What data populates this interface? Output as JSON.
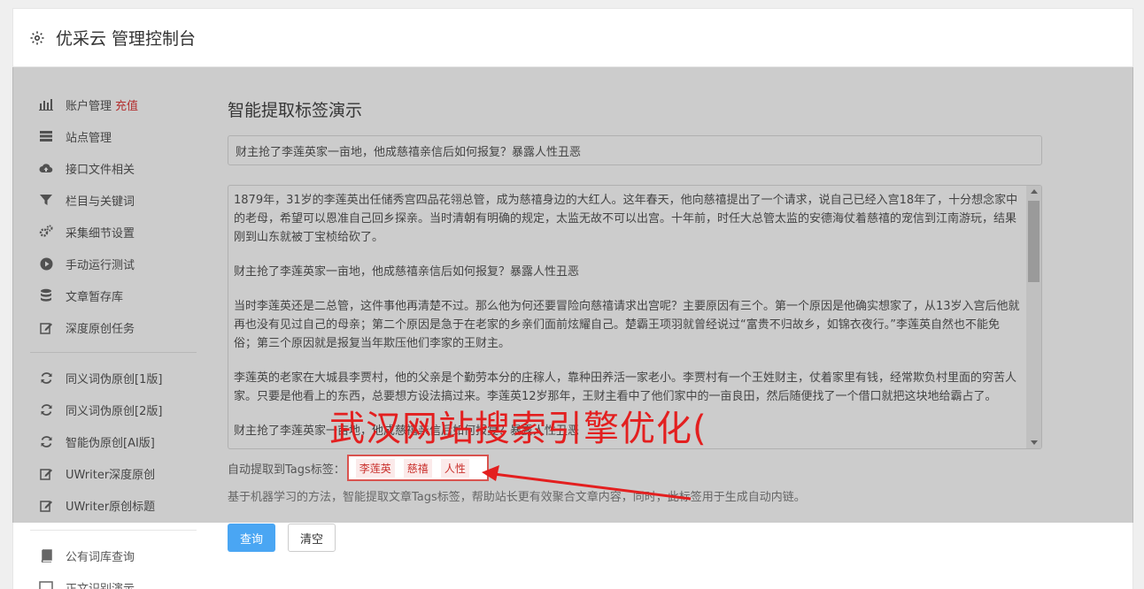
{
  "header": {
    "title": "优采云 管理控制台",
    "icon": "gear-icon"
  },
  "sidebar": {
    "items": [
      {
        "label": "账户管理",
        "badge": "充值",
        "icon": "bar-chart-icon"
      },
      {
        "label": "站点管理",
        "icon": "server-icon"
      },
      {
        "label": "接口文件相关",
        "icon": "cloud-upload-icon"
      },
      {
        "label": "栏目与关键词",
        "icon": "filter-icon"
      },
      {
        "label": "采集细节设置",
        "icon": "gears-icon"
      },
      {
        "label": "手动运行测试",
        "icon": "play-circle-icon"
      },
      {
        "label": "文章暂存库",
        "icon": "database-icon"
      },
      {
        "label": "深度原创任务",
        "icon": "edit-icon"
      }
    ],
    "items2": [
      {
        "label": "同义词伪原创[1版]",
        "icon": "refresh-icon"
      },
      {
        "label": "同义词伪原创[2版]",
        "icon": "refresh-icon"
      },
      {
        "label": "智能伪原创[AI版]",
        "icon": "refresh-icon"
      },
      {
        "label": "UWriter深度原创",
        "icon": "edit-icon"
      },
      {
        "label": "UWriter原创标题",
        "icon": "edit-icon"
      }
    ],
    "items3": [
      {
        "label": "公有词库查询",
        "icon": "book-icon"
      },
      {
        "label": "正文识别演示",
        "icon": "monitor-icon"
      }
    ]
  },
  "main": {
    "title": "智能提取标签演示",
    "title_input_value": "财主抢了李莲英家一亩地，他成慈禧亲信后如何报复？暴露人性丑恶",
    "content_paragraphs": [
      "1879年，31岁的李莲英出任储秀宫四品花翎总管，成为慈禧身边的大红人。这年春天，他向慈禧提出了一个请求，说自己已经入宫18年了，十分想念家中的老母，希望可以恩准自己回乡探亲。当时清朝有明确的规定，太监无故不可以出宫。十年前，时任大总管太监的安德海仗着慈禧的宠信到江南游玩，结果刚到山东就被丁宝桢给砍了。",
      "财主抢了李莲英家一亩地，他成慈禧亲信后如何报复？暴露人性丑恶",
      "当时李莲英还是二总管，这件事他再清楚不过。那么他为何还要冒险向慈禧请求出宫呢？主要原因有三个。第一个原因是他确实想家了，从13岁入宫后他就再也没有见过自己的母亲；第二个原因是急于在老家的乡亲们面前炫耀自己。楚霸王项羽就曾经说过“富贵不归故乡，如锦衣夜行。”李莲英自然也不能免俗；第三个原因就是报复当年欺压他们李家的王财主。",
      "李莲英的老家在大城县李贾村，他的父亲是个勤劳本分的庄稼人，靠种田养活一家老小。李贾村有一个王姓财主，仗着家里有钱，经常欺负村里面的穷苦人家。只要是他看上的东西，总要想方设法搞过来。李莲英12岁那年，王财主看中了他们家中的一亩良田，然后随便找了一个借口就把这块地给霸占了。",
      "财主抢了李莲英家一亩地，他成慈禧亲信后如何报复？暴露人性丑恶"
    ],
    "tags_label": "自动提取到Tags标签：",
    "tags": [
      "李莲英",
      "慈禧",
      "人性"
    ],
    "description": "基于机器学习的方法，智能提取文章Tags标签，帮助站长更有效聚合文章内容，同时，此标签用于生成自动内链。",
    "query_button": "查询",
    "clear_button": "清空"
  },
  "watermark": {
    "text": "武汉网站搜索引擎优化(",
    "color": "#e31f1f"
  },
  "colors": {
    "accent": "#4aa6f3",
    "badge": "#e03c3c",
    "tag": "#c9302c"
  }
}
